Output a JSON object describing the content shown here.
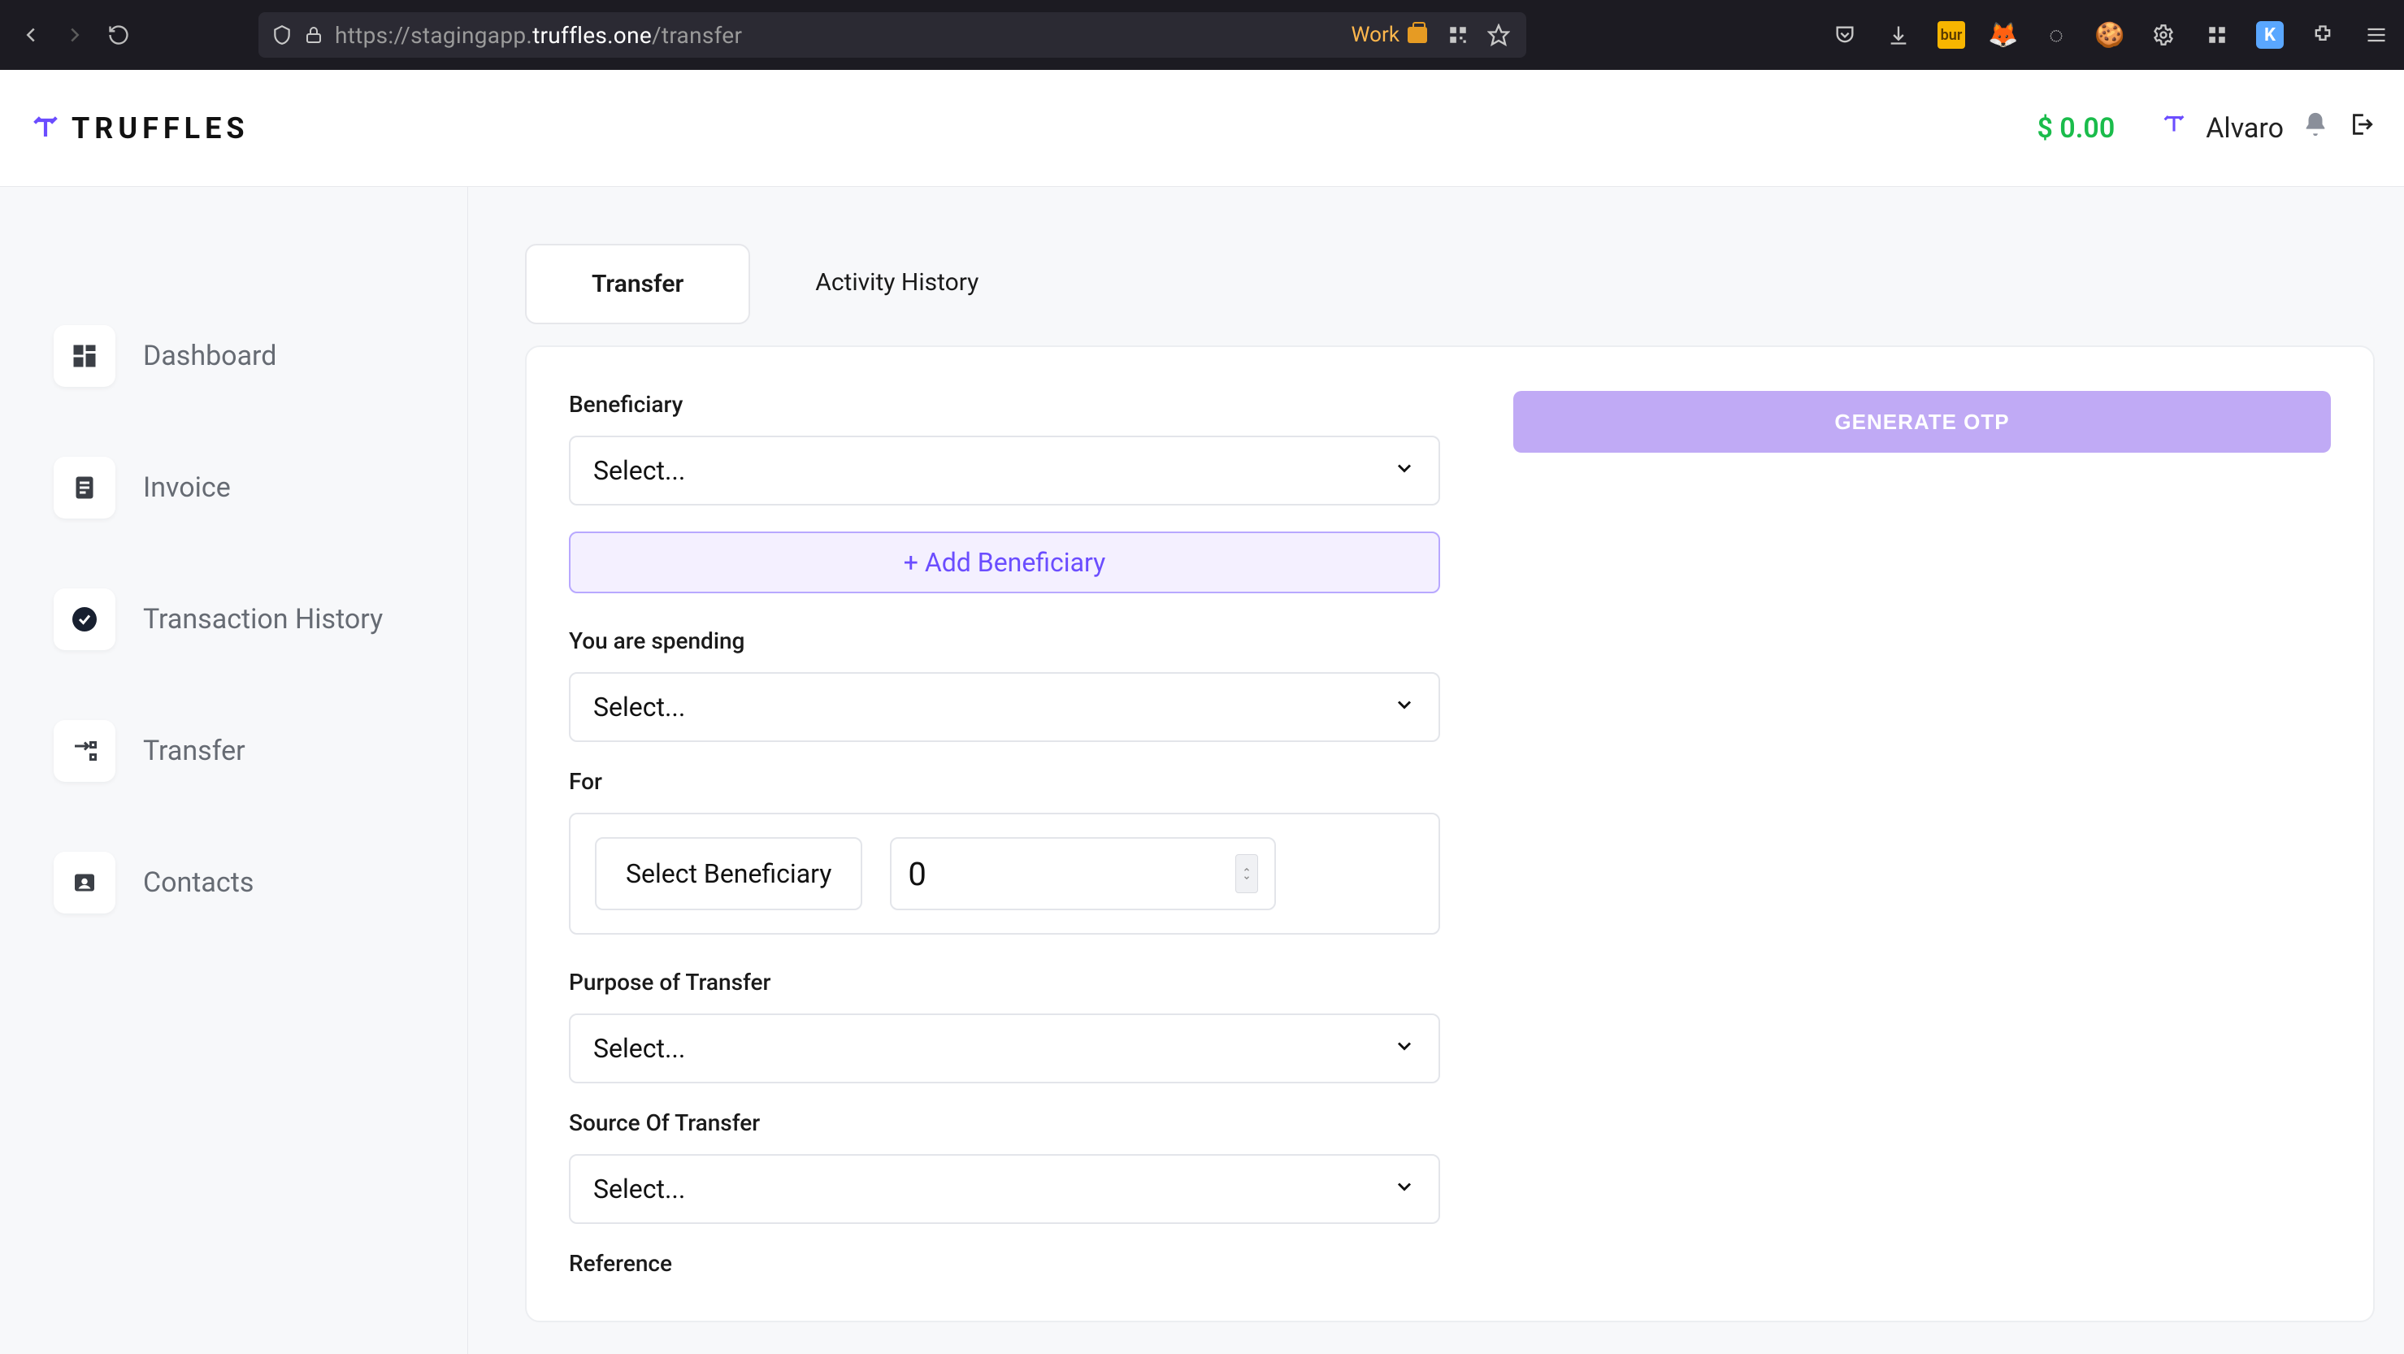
{
  "browser": {
    "url_prefix": "https://stagingapp.",
    "url_bold": "truffles.one",
    "url_suffix": "/transfer",
    "container_label": "Work"
  },
  "header": {
    "brand": "TRUFFLES",
    "balance": "$ 0.00",
    "user_name": "Alvaro"
  },
  "sidebar": {
    "items": [
      {
        "label": "Dashboard"
      },
      {
        "label": "Invoice"
      },
      {
        "label": "Transaction History"
      },
      {
        "label": "Transfer"
      },
      {
        "label": "Contacts"
      }
    ]
  },
  "tabs": {
    "transfer": "Transfer",
    "activity": "Activity History"
  },
  "form": {
    "beneficiary_label": "Beneficiary",
    "beneficiary_placeholder": "Select...",
    "add_beneficiary": "+ Add Beneficiary",
    "spending_label": "You are spending",
    "spending_placeholder": "Select...",
    "for_label": "For",
    "for_chip": "Select Beneficiary",
    "for_value": "0",
    "purpose_label": "Purpose of Transfer",
    "purpose_placeholder": "Select...",
    "source_label": "Source Of Transfer",
    "source_placeholder": "Select...",
    "reference_label": "Reference"
  },
  "actions": {
    "generate_otp": "GENERATE OTP"
  }
}
